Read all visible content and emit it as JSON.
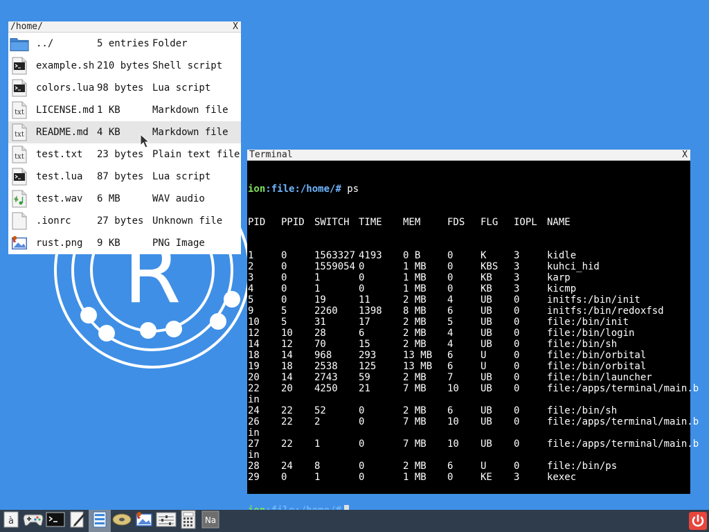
{
  "file_manager": {
    "title": "/home/",
    "close_label": "X",
    "entries": [
      {
        "name": "../",
        "size": "5 entries",
        "type": "Folder",
        "icon": "folder-icon"
      },
      {
        "name": "example.sh",
        "size": "210 bytes",
        "type": "Shell script",
        "icon": "terminal-file-icon"
      },
      {
        "name": "colors.lua",
        "size": "98 bytes",
        "type": "Lua script",
        "icon": "terminal-file-icon"
      },
      {
        "name": "LICENSE.md",
        "size": "1 KB",
        "type": "Markdown file",
        "icon": "text-file-icon"
      },
      {
        "name": "README.md",
        "size": "4 KB",
        "type": "Markdown file",
        "icon": "text-file-icon"
      },
      {
        "name": "test.txt",
        "size": "23 bytes",
        "type": "Plain text file",
        "icon": "text-file-icon"
      },
      {
        "name": "test.lua",
        "size": "87 bytes",
        "type": "Lua script",
        "icon": "terminal-file-icon"
      },
      {
        "name": "test.wav",
        "size": "6 MB",
        "type": "WAV audio",
        "icon": "audio-file-icon"
      },
      {
        "name": ".ionrc",
        "size": "27 bytes",
        "type": "Unknown file",
        "icon": "unknown-file-icon"
      },
      {
        "name": "rust.png",
        "size": "9 KB",
        "type": "PNG Image",
        "icon": "image-file-icon"
      }
    ],
    "selected_index": 4
  },
  "terminal": {
    "title": "Terminal",
    "close_label": "X",
    "prompt_ion": "ion",
    "prompt_path": ":file:/home/#",
    "command": " ps",
    "headers": [
      "PID",
      "PPID",
      "SWITCH",
      "TIME",
      "MEM",
      "FDS",
      "FLG",
      "IOPL",
      "NAME"
    ],
    "rows": [
      [
        "1",
        "0",
        "1563327",
        "4193",
        "0 B",
        "0",
        "K",
        "3",
        "kidle"
      ],
      [
        "2",
        "0",
        "1559054",
        "0",
        "1 MB",
        "0",
        "KBS",
        "3",
        "kuhci_hid"
      ],
      [
        "3",
        "0",
        "1",
        "0",
        "1 MB",
        "0",
        "KB",
        "3",
        "karp"
      ],
      [
        "4",
        "0",
        "1",
        "0",
        "1 MB",
        "0",
        "KB",
        "3",
        "kicmp"
      ],
      [
        "5",
        "0",
        "19",
        "11",
        "2 MB",
        "4",
        "UB",
        "0",
        "initfs:/bin/init"
      ],
      [
        "9",
        "5",
        "2260",
        "1398",
        "8 MB",
        "6",
        "UB",
        "0",
        "initfs:/bin/redoxfsd"
      ],
      [
        "10",
        "5",
        "31",
        "17",
        "2 MB",
        "5",
        "UB",
        "0",
        "file:/bin/init"
      ],
      [
        "12",
        "10",
        "28",
        "6",
        "2 MB",
        "4",
        "UB",
        "0",
        "file:/bin/login"
      ],
      [
        "14",
        "12",
        "70",
        "15",
        "2 MB",
        "4",
        "UB",
        "0",
        "file:/bin/sh"
      ],
      [
        "18",
        "14",
        "968",
        "293",
        "13 MB",
        "6",
        "U",
        "0",
        "file:/bin/orbital"
      ],
      [
        "19",
        "18",
        "2538",
        "125",
        "13 MB",
        "6",
        "U",
        "0",
        "file:/bin/orbital"
      ],
      [
        "20",
        "14",
        "2743",
        "59",
        "2 MB",
        "7",
        "UB",
        "0",
        "file:/bin/launcher"
      ],
      [
        "22",
        "20",
        "4250",
        "21",
        "7 MB",
        "10",
        "UB",
        "0",
        "file:/apps/terminal/main.b",
        "in"
      ],
      [
        "24",
        "22",
        "52",
        "0",
        "2 MB",
        "6",
        "UB",
        "0",
        "file:/bin/sh"
      ],
      [
        "26",
        "22",
        "2",
        "0",
        "7 MB",
        "10",
        "UB",
        "0",
        "file:/apps/terminal/main.b",
        "in"
      ],
      [
        "27",
        "22",
        "1",
        "0",
        "7 MB",
        "10",
        "UB",
        "0",
        "file:/apps/terminal/main.b",
        "in"
      ],
      [
        "28",
        "24",
        "8",
        "0",
        "2 MB",
        "6",
        "U",
        "0",
        "file:/bin/ps"
      ],
      [
        "29",
        "0",
        "1",
        "0",
        "1 MB",
        "0",
        "KE",
        "3",
        "kexec"
      ]
    ]
  },
  "taskbar": {
    "items": [
      {
        "name": "file-manager-home-icon",
        "label": "à"
      },
      {
        "name": "gamepad-icon",
        "label": ""
      },
      {
        "name": "terminal-icon",
        "label": ""
      },
      {
        "name": "editor-pen-icon",
        "label": ""
      },
      {
        "name": "file-browser-icon",
        "label": ""
      },
      {
        "name": "disk-icon",
        "label": ""
      },
      {
        "name": "image-viewer-icon",
        "label": ""
      },
      {
        "name": "settings-panel-icon",
        "label": ""
      },
      {
        "name": "calculator-icon",
        "label": ""
      },
      {
        "name": "periodic-table-icon",
        "label": "Na"
      }
    ],
    "power_icon": "power-icon",
    "active_index": 4
  },
  "colors": {
    "desktop": "#3f8fe6",
    "taskbar": "#2e3c4c",
    "prompt_ion": "#7ee05a",
    "prompt_path": "#6fb6ff",
    "power": "#e8453c"
  }
}
